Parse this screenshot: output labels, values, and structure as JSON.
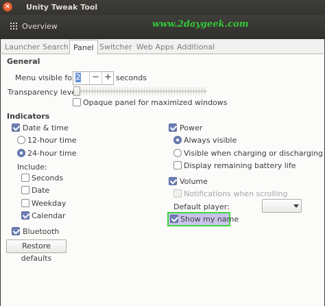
{
  "window": {
    "title": "Unity Tweak Tool",
    "close_glyph": "×"
  },
  "toolbar": {
    "overview_label": "Overview",
    "watermark": "www.2daygeek.com"
  },
  "tabs": [
    "Launcher",
    "Search",
    "Panel",
    "Switcher",
    "Web Apps",
    "Additional"
  ],
  "active_tab": "Panel",
  "general": {
    "heading": "General",
    "menu_visible_label": "Menu visible for:",
    "menu_visible_value": "2",
    "spin_minus": "−",
    "spin_plus": "+",
    "seconds_label": "seconds",
    "transparency_label": "Transparency level:",
    "transparency_value": 0,
    "opaque_label": "Opaque panel for maximized windows",
    "opaque_checked": false
  },
  "indicators": {
    "heading": "Indicators",
    "datetime": {
      "label": "Date & time",
      "checked": true,
      "hour12_label": "12-hour time",
      "hour24_label": "24-hour time",
      "selected": "24-hour time",
      "include_label": "Include:",
      "seconds_label": "Seconds",
      "seconds_checked": false,
      "date_label": "Date",
      "date_checked": false,
      "weekday_label": "Weekday",
      "weekday_checked": false,
      "calendar_label": "Calendar",
      "calendar_checked": true
    },
    "bluetooth": {
      "label": "Bluetooth",
      "checked": true
    },
    "power": {
      "label": "Power",
      "checked": true,
      "always_visible_label": "Always visible",
      "charging_label": "Visible when charging or discharging",
      "selected": "Always visible",
      "battery_life_label": "Display remaining battery life",
      "battery_life_checked": false
    },
    "volume": {
      "label": "Volume",
      "checked": true,
      "notifications_label": "Notifications when scrolling",
      "notifications_enabled": false,
      "default_player_label": "Default player:",
      "default_player_value": ""
    },
    "show_name": {
      "label": "Show my name",
      "checked": true
    }
  },
  "restore_label": "Restore defaults",
  "colors": {
    "highlight_border": "#3fd63f",
    "accent": "#6c7fb5",
    "close": "#e8663b"
  }
}
